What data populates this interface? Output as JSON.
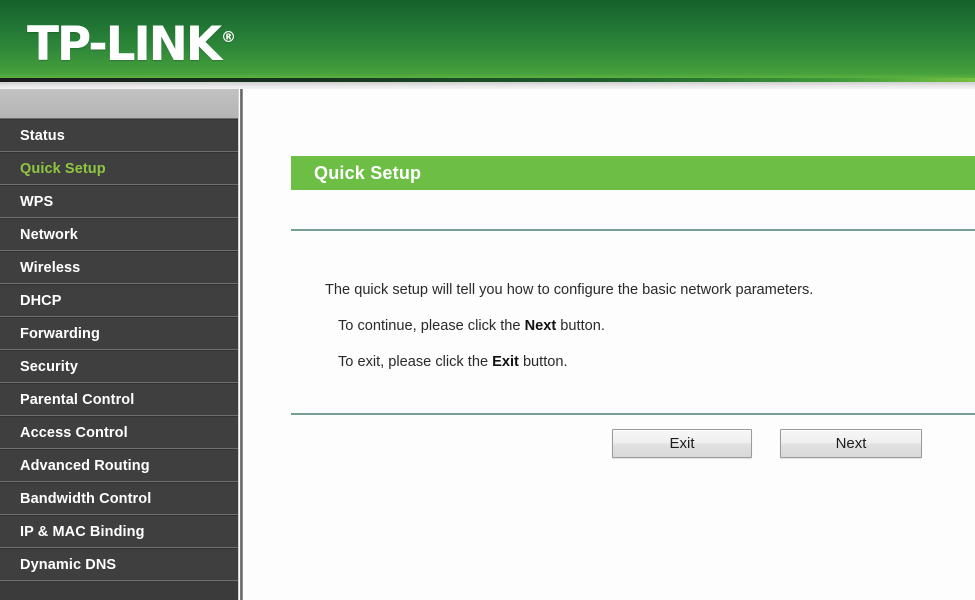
{
  "header": {
    "brand": "TP-LINK",
    "trademark": "®",
    "brand_color": "#ffffff",
    "gradient_top": "#15612c",
    "gradient_bottom": "#5cb23f"
  },
  "sidebar": {
    "background": "#3f3f3f",
    "active_color": "#8fc640",
    "items": [
      {
        "label": "Status",
        "active": false
      },
      {
        "label": "Quick Setup",
        "active": true
      },
      {
        "label": "WPS",
        "active": false
      },
      {
        "label": "Network",
        "active": false
      },
      {
        "label": "Wireless",
        "active": false
      },
      {
        "label": "DHCP",
        "active": false
      },
      {
        "label": "Forwarding",
        "active": false
      },
      {
        "label": "Security",
        "active": false
      },
      {
        "label": "Parental Control",
        "active": false
      },
      {
        "label": "Access Control",
        "active": false
      },
      {
        "label": "Advanced Routing",
        "active": false
      },
      {
        "label": "Bandwidth Control",
        "active": false
      },
      {
        "label": "IP & MAC Binding",
        "active": false
      },
      {
        "label": "Dynamic DNS",
        "active": false
      }
    ]
  },
  "main": {
    "panel_title": "Quick Setup",
    "panel_title_bg": "#6cbe45",
    "divider_color": "#5f8c82",
    "paragraphs": {
      "intro": "The quick setup will tell you how to configure the basic network parameters.",
      "continue_prefix": "To continue, please click the ",
      "continue_bold": "Next",
      "continue_suffix": " button.",
      "exit_prefix": "To exit, please click the ",
      "exit_bold": "Exit",
      "exit_suffix": "  button."
    },
    "buttons": {
      "exit_label": "Exit",
      "next_label": "Next"
    }
  }
}
